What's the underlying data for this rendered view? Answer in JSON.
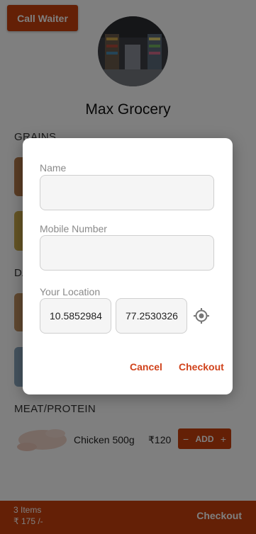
{
  "header": {
    "call_waiter_label": "Call Waiter",
    "store_name": "Max Grocery"
  },
  "sections": [
    {
      "title": "GRAINS"
    },
    {
      "title": "DA"
    },
    {
      "title": "MEAT/PROTEIN"
    }
  ],
  "item": {
    "name": "Chicken 500g",
    "price": "₹120",
    "add_label": "ADD",
    "minus": "−",
    "plus": "+"
  },
  "cart": {
    "count_text": "3 Items",
    "total_text": "₹ 175 /-",
    "checkout_label": "Checkout"
  },
  "dialog": {
    "name_label": "Name",
    "name_value": "",
    "mobile_label": "Mobile Number",
    "mobile_value": "",
    "location_label": "Your Location",
    "latitude": "10.5852984",
    "longitude": "77.2530326",
    "locate_icon": "gps-target-icon",
    "cancel_label": "Cancel",
    "checkout_label": "Checkout"
  },
  "colors": {
    "accent": "#c8410d",
    "dialog_button": "#d0421b"
  }
}
